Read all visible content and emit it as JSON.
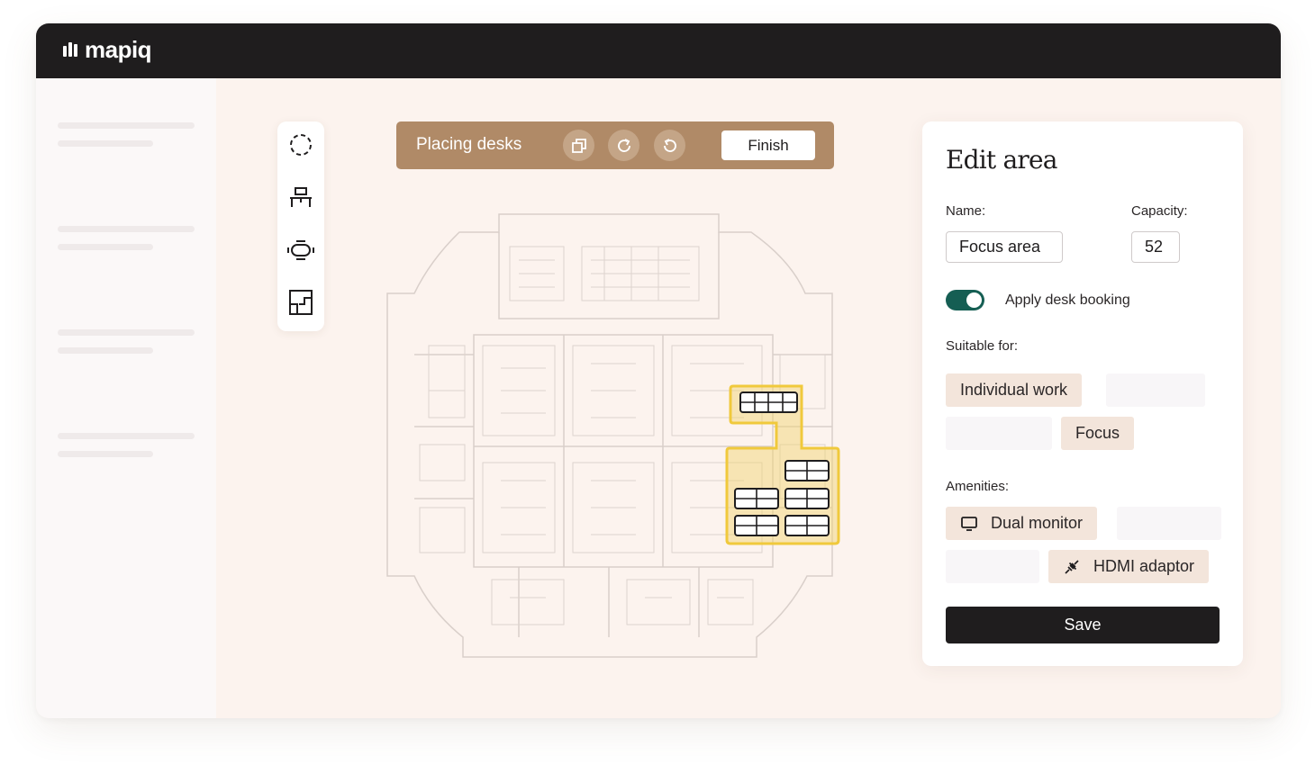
{
  "brand": {
    "name": "mapiq"
  },
  "placing_bar": {
    "label": "Placing desks",
    "finish_label": "Finish",
    "icons": [
      "duplicate-icon",
      "rotate-clockwise-icon",
      "undo-icon"
    ]
  },
  "tools": [
    "area-select-icon",
    "desk-icon",
    "meeting-table-icon",
    "floor-plan-icon"
  ],
  "edit_panel": {
    "title": "Edit area",
    "name_label": "Name:",
    "name_value": "Focus area",
    "capacity_label": "Capacity:",
    "capacity_value": "52",
    "toggle_label": "Apply desk booking",
    "toggle_on": true,
    "suitable_label": "Suitable for:",
    "suitable_for": [
      "Individual work",
      "Focus"
    ],
    "amenities_label": "Amenities:",
    "amenities": [
      "Dual monitor",
      "HDMI adaptor"
    ],
    "save_label": "Save"
  },
  "colors": {
    "topbar": "#1f1d1e",
    "accent_brown": "#b08a67",
    "toggle_green": "#155e53",
    "selection_yellow": "#f2d36b",
    "chip_selected": "#f3e5db"
  }
}
